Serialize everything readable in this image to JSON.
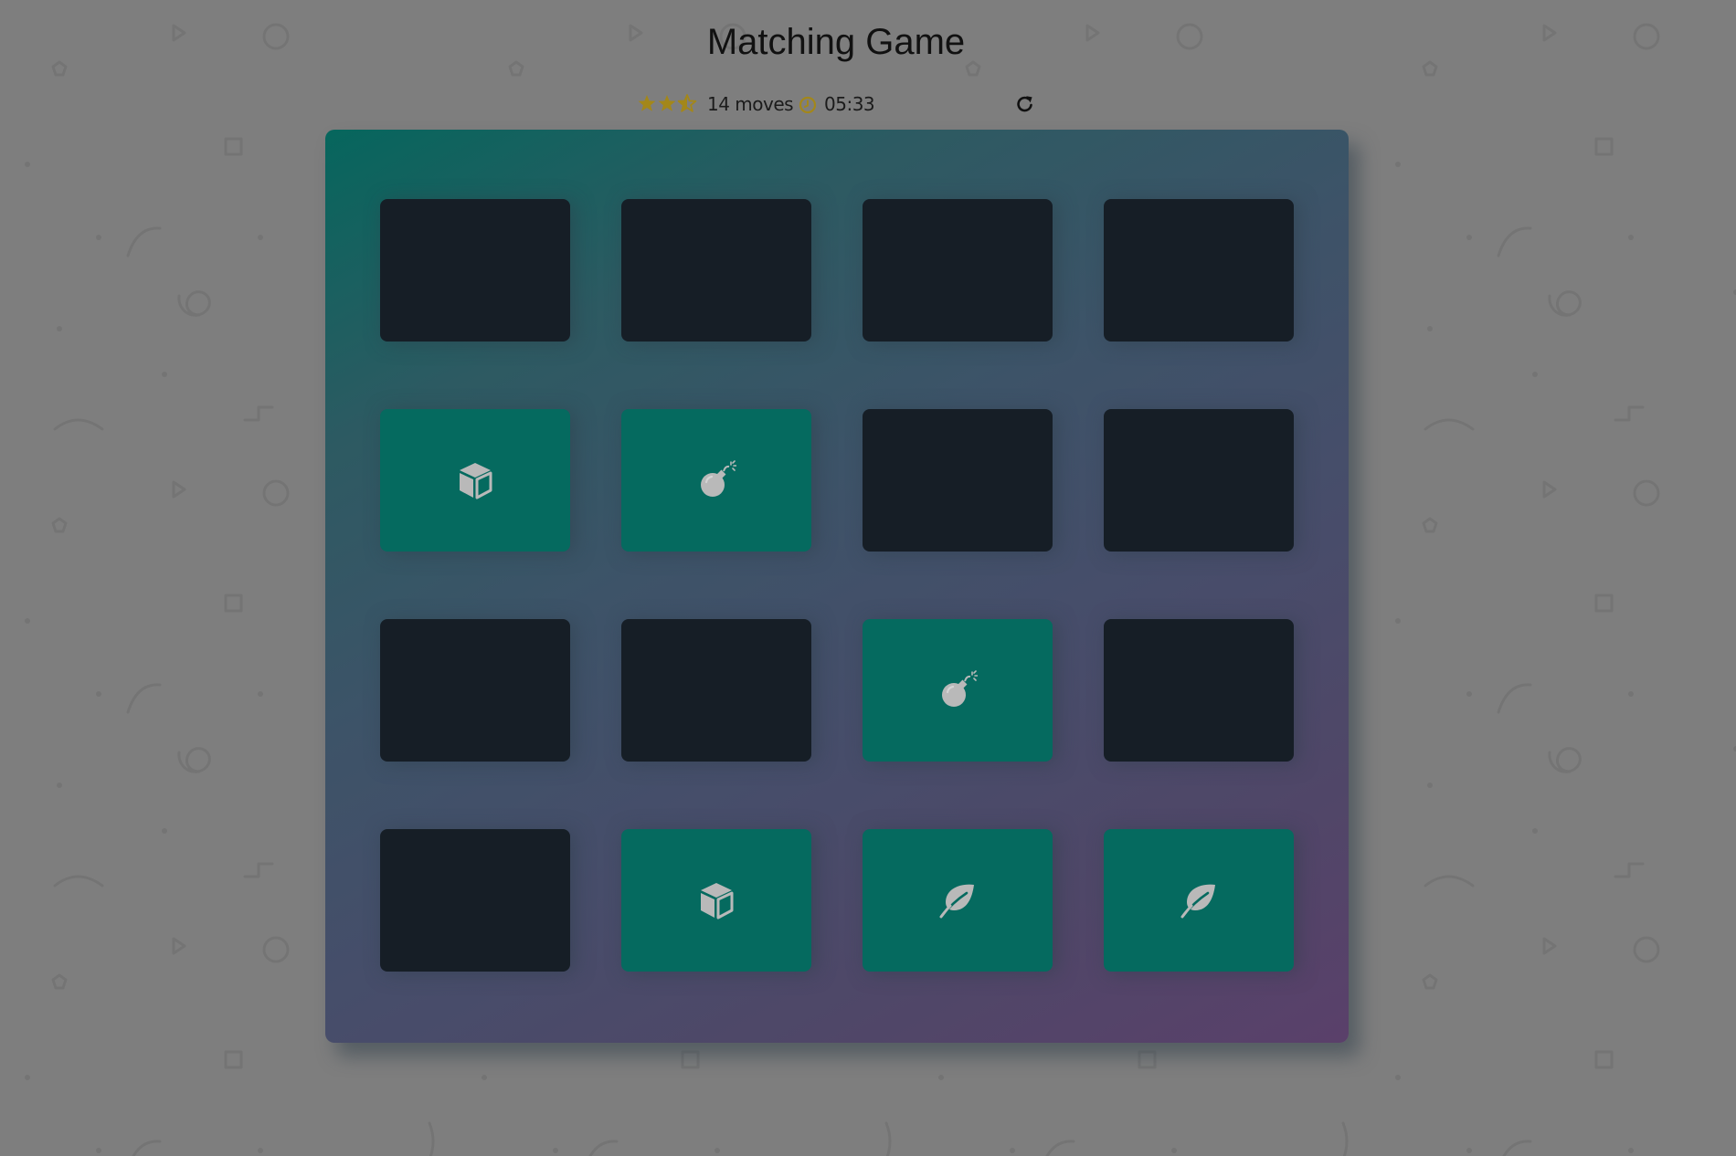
{
  "title": "Matching Game",
  "score_panel": {
    "stars": {
      "rating": 2.5,
      "max": 5,
      "icon": "star-icon",
      "color": "#a3871a"
    },
    "moves_label": "14 moves",
    "timer_icon": "clock-icon",
    "timer": "05:33",
    "restart_icon": "restart-icon"
  },
  "deck": {
    "gradient_colors": [
      "#06665d",
      "#5a406a"
    ],
    "card_closed_color": "#161e26",
    "card_open_color": "#056a5f",
    "cards": [
      {
        "state": "closed",
        "icon": null
      },
      {
        "state": "closed",
        "icon": null
      },
      {
        "state": "closed",
        "icon": null
      },
      {
        "state": "closed",
        "icon": null
      },
      {
        "state": "open",
        "icon": "cube-icon"
      },
      {
        "state": "open",
        "icon": "bomb-icon"
      },
      {
        "state": "closed",
        "icon": null
      },
      {
        "state": "closed",
        "icon": null
      },
      {
        "state": "closed",
        "icon": null
      },
      {
        "state": "closed",
        "icon": null
      },
      {
        "state": "open",
        "icon": "bomb-icon"
      },
      {
        "state": "closed",
        "icon": null
      },
      {
        "state": "closed",
        "icon": null
      },
      {
        "state": "open",
        "icon": "cube-icon"
      },
      {
        "state": "open",
        "icon": "leaf-icon"
      },
      {
        "state": "open",
        "icon": "leaf-icon"
      }
    ]
  }
}
